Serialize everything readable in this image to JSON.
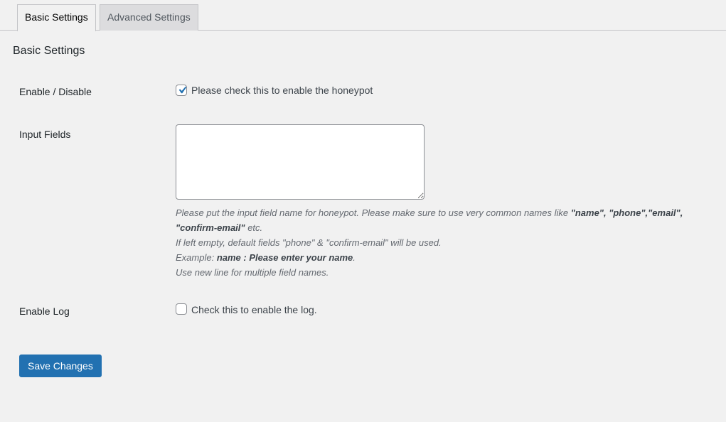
{
  "tabs": [
    {
      "label": "Basic Settings",
      "active": true
    },
    {
      "label": "Advanced Settings",
      "active": false
    }
  ],
  "section_title": "Basic Settings",
  "fields": {
    "enable": {
      "label": "Enable / Disable",
      "checkbox_label": "Please check this to enable the honeypot",
      "checked": true
    },
    "input_fields": {
      "label": "Input Fields",
      "value": "",
      "description": {
        "line1_text": "Please put the input field name for honeypot. Please make sure to use very common names like ",
        "line1_names": "\"name\", \"phone\",\"email\", \"confirm-email\"",
        "line1_end": " etc.",
        "line2": "If left empty, default fields \"phone\" & \"confirm-email\" will be used.",
        "example_prefix": "Example: ",
        "example_value": "name : Please enter your name",
        "example_end": ".",
        "line4": "Use new line for multiple field names."
      }
    },
    "enable_log": {
      "label": "Enable Log",
      "checkbox_label": "Check this to enable the log.",
      "checked": false
    }
  },
  "save_label": "Save Changes",
  "colors": {
    "background": "#f1f1f1",
    "primary_button": "#2271b1",
    "checkmark": "#2271b1"
  }
}
